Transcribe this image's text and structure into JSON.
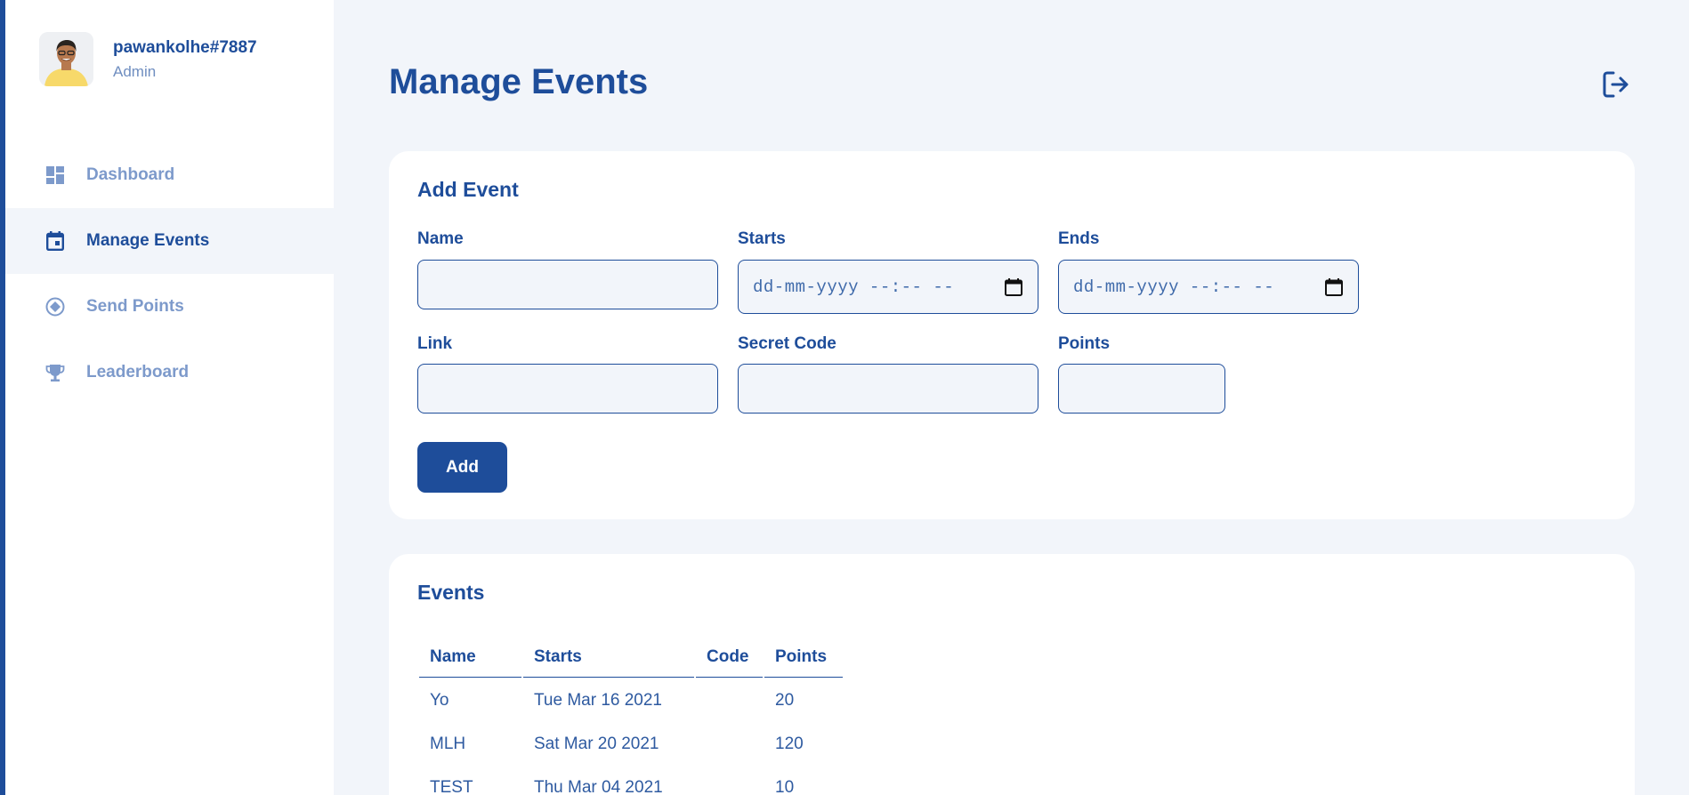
{
  "user": {
    "name": "pawankolhe#7887",
    "role": "Admin"
  },
  "nav": [
    {
      "label": "Dashboard",
      "icon": "dashboard-icon",
      "active": false
    },
    {
      "label": "Manage Events",
      "icon": "calendar-icon",
      "active": true
    },
    {
      "label": "Send Points",
      "icon": "diamond-coin-icon",
      "active": false
    },
    {
      "label": "Leaderboard",
      "icon": "trophy-icon",
      "active": false
    }
  ],
  "page": {
    "title": "Manage Events"
  },
  "add_event": {
    "title": "Add Event",
    "name_label": "Name",
    "name_value": "",
    "starts_label": "Starts",
    "starts_placeholder": "dd-mm-yyyy --:-- --",
    "ends_label": "Ends",
    "ends_placeholder": "dd-mm-yyyy --:-- --",
    "link_label": "Link",
    "link_value": "",
    "code_label": "Secret Code",
    "code_value": "",
    "points_label": "Points",
    "points_value": "",
    "add_button": "Add"
  },
  "events": {
    "title": "Events",
    "columns": [
      "Name",
      "Starts",
      "Code",
      "Points"
    ],
    "rows": [
      {
        "name": "Yo",
        "starts": "Tue Mar 16 2021",
        "code": "",
        "points": "20"
      },
      {
        "name": "MLH",
        "starts": "Sat Mar 20 2021",
        "code": "",
        "points": "120"
      },
      {
        "name": "TEST",
        "starts": "Thu Mar 04 2021",
        "code": "",
        "points": "10"
      }
    ]
  },
  "colors": {
    "primary": "#1e4d9a",
    "muted": "#7d9acb",
    "background": "#f2f5fa",
    "card": "#ffffff"
  }
}
